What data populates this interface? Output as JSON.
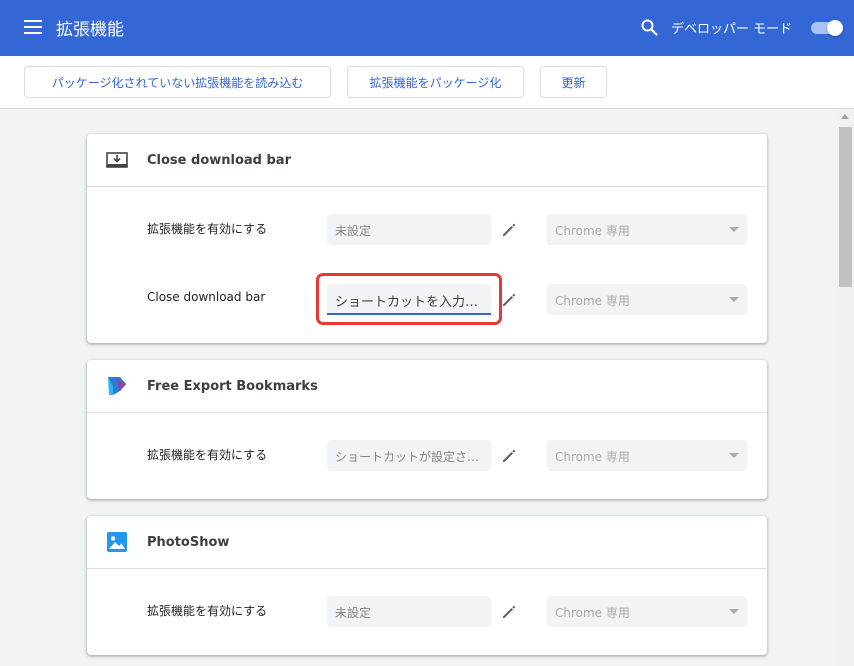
{
  "header": {
    "title": "拡張機能",
    "search_icon": "search-icon",
    "developer_mode_label": "デベロッパー モード",
    "developer_mode_on": true
  },
  "toolbar": {
    "load_unpacked": "パッケージ化されていない拡張機能を読み込む",
    "pack_extension": "拡張機能をパッケージ化",
    "update": "更新"
  },
  "extensions": [
    {
      "name": "Close download bar",
      "icon": "download-bar-icon",
      "rows": [
        {
          "label": "拡張機能を有効にする",
          "shortcut": "未設定",
          "scope": "Chrome 専用"
        },
        {
          "label": "Close download bar",
          "shortcut": "ショートカットを入力する",
          "scope": "Chrome 専用"
        }
      ]
    },
    {
      "name": "Free Export Bookmarks",
      "icon": "bookmark-export-icon",
      "rows": [
        {
          "label": "拡張機能を有効にする",
          "shortcut": "ショートカットが設定されていません",
          "scope": "Chrome 専用"
        }
      ]
    },
    {
      "name": "PhotoShow",
      "icon": "photo-icon",
      "rows": [
        {
          "label": "拡張機能を有効にする",
          "shortcut": "未設定",
          "scope": "Chrome 専用"
        }
      ]
    }
  ],
  "colors": {
    "header_bg": "#3367d6",
    "accent": "#3367d6",
    "highlight": "#e53935"
  }
}
